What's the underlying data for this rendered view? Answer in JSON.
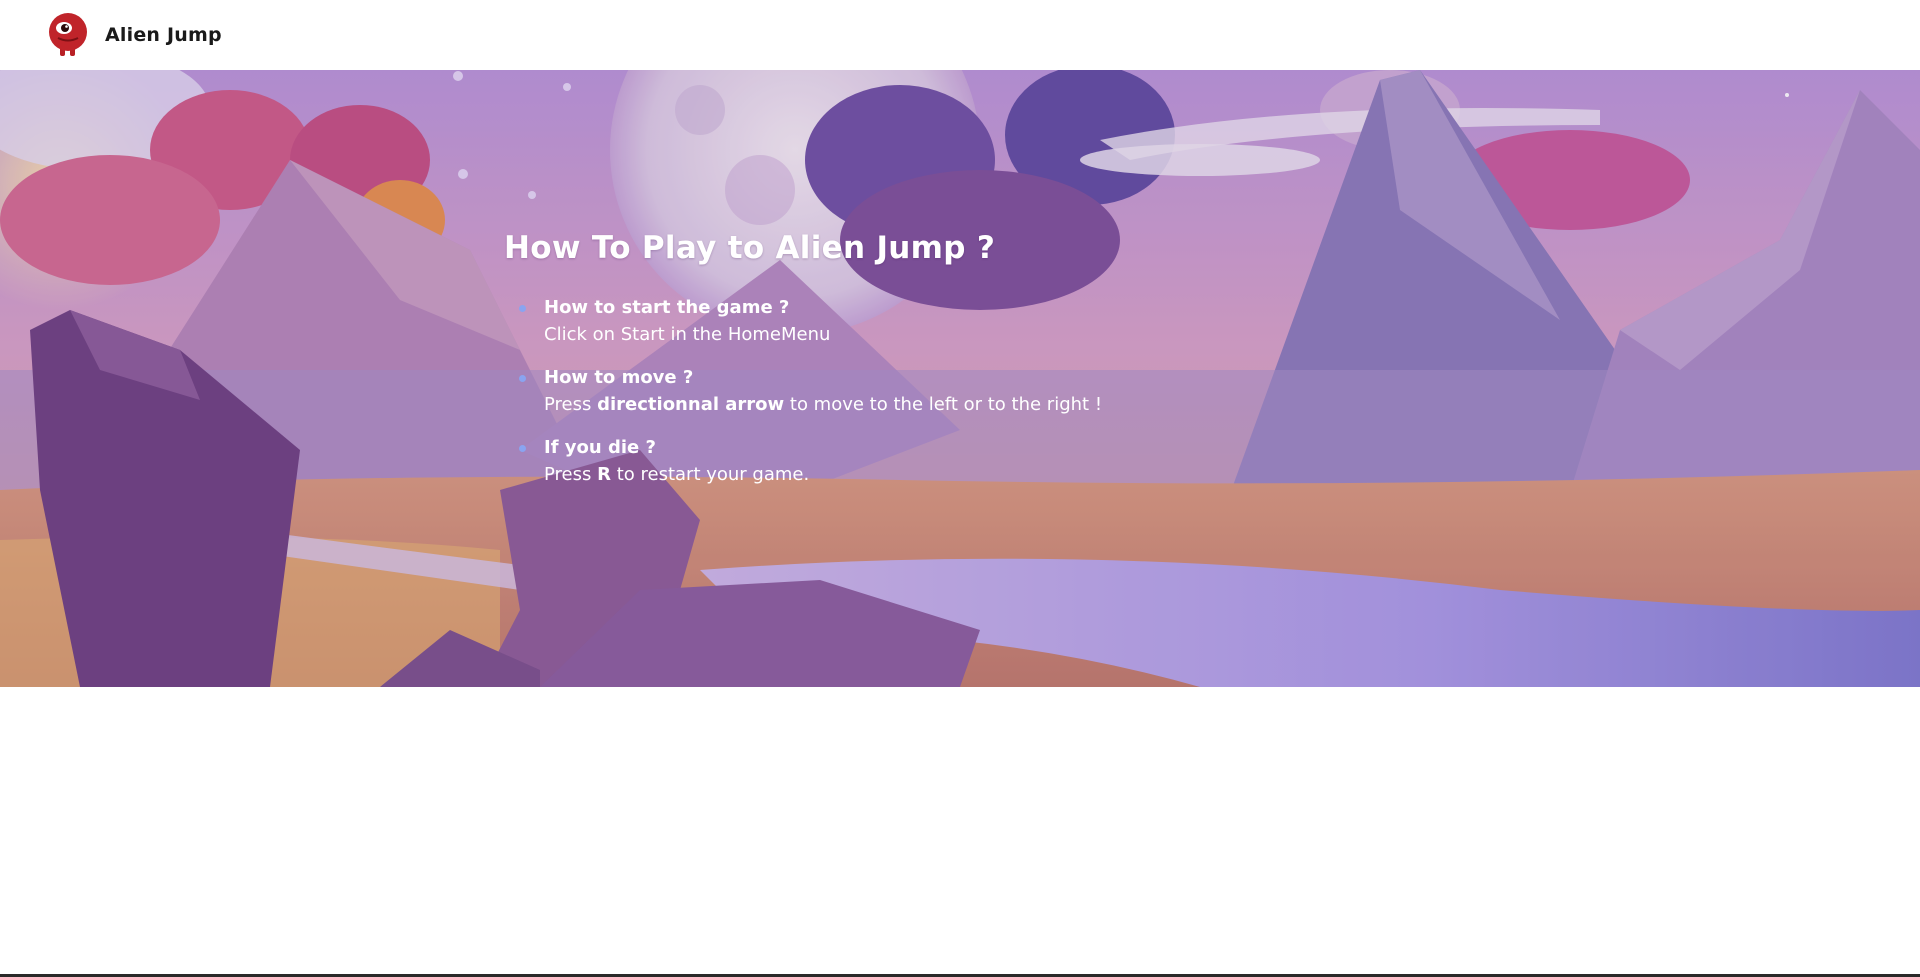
{
  "header": {
    "title": "Alien Jump",
    "logo_icon": "alien-logo-icon"
  },
  "hero": {
    "title": "How To Play to Alien Jump ?",
    "steps": [
      {
        "question": "How to start the game ?",
        "answer": "Click on Start in the HomeMenu"
      },
      {
        "question": "How to move ?",
        "answer_prefix": "Press ",
        "answer_strong": "directionnal arrow",
        "answer_suffix": " to move to the left or to the right !"
      },
      {
        "question": "If you die ?",
        "answer_prefix": "Press ",
        "answer_strong": "R",
        "answer_suffix": " to restart your game."
      }
    ]
  },
  "colors": {
    "bullet": "#8aa4f0",
    "sky_top": "#b58fd6",
    "mountain": "#9c86c4",
    "logo_red": "#c0242a"
  }
}
